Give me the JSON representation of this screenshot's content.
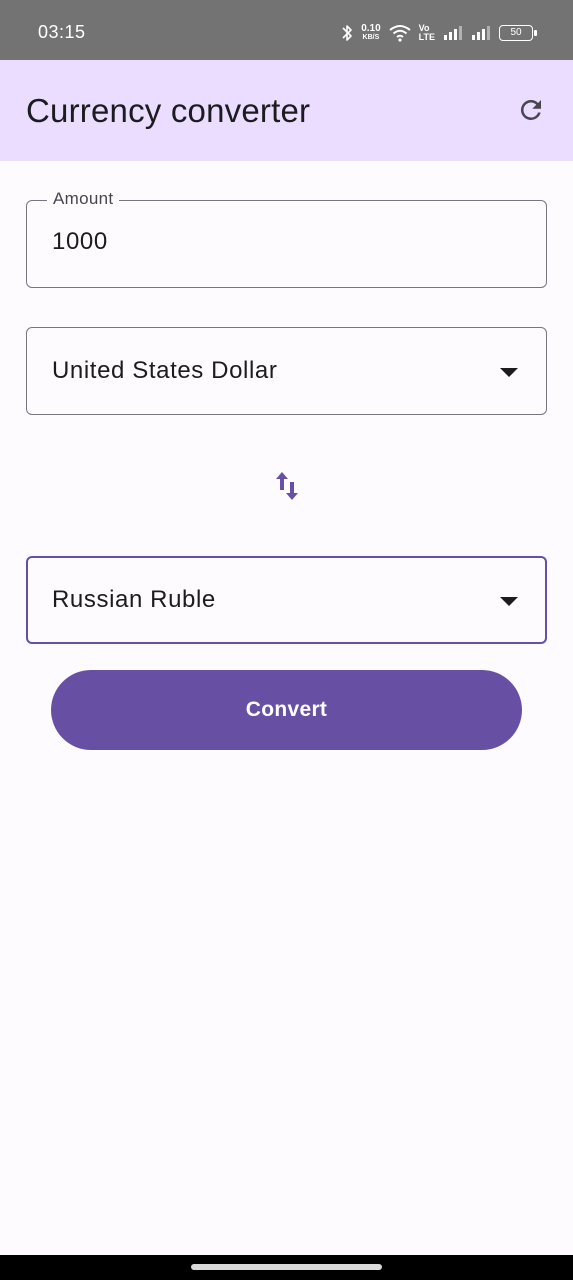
{
  "status_bar": {
    "time": "03:15",
    "network_speed_value": "0.10",
    "network_speed_unit": "KB/S",
    "volte_top": "Vo",
    "volte_bottom": "LTE",
    "battery_level": "50",
    "icons": [
      "bluetooth-icon",
      "wifi-icon",
      "signal-icon",
      "signal-icon",
      "battery-icon"
    ]
  },
  "app_bar": {
    "title": "Currency converter",
    "refresh_icon": "refresh-icon",
    "background_color": "#eaddff"
  },
  "amount_field": {
    "label": "Amount",
    "value": "1000"
  },
  "from_currency": {
    "selected": "United States Dollar",
    "arrow_icon": "dropdown-arrow-icon"
  },
  "swap": {
    "icon": "swap-vert-icon"
  },
  "to_currency": {
    "selected": "Russian Ruble",
    "arrow_icon": "dropdown-arrow-icon",
    "focused": true
  },
  "convert_button": {
    "label": "Convert",
    "color": "#6750a4"
  },
  "colors": {
    "primary": "#6750a4",
    "surface": "#fefbff",
    "outline": "#79747e",
    "on_surface": "#1c1b1f"
  }
}
